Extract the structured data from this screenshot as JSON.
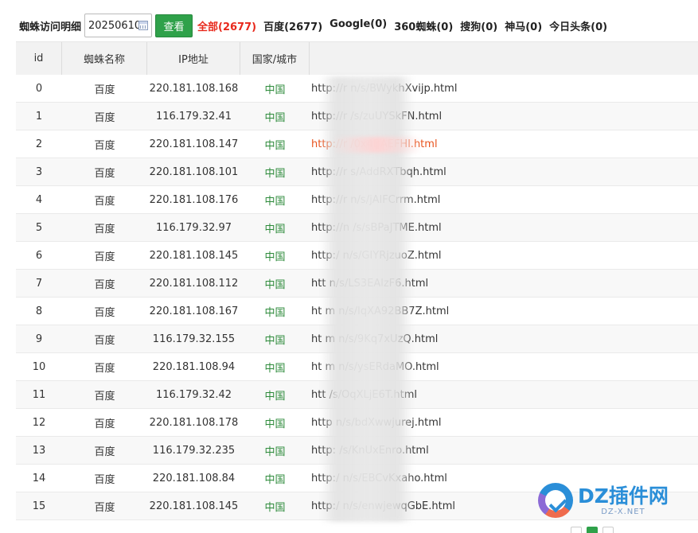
{
  "toolbar": {
    "title": "蜘蛛访问明细",
    "date_value": "20250610",
    "view_label": "查看",
    "filters": [
      {
        "label": "全部(2677)",
        "active": true
      },
      {
        "label": "百度(2677)",
        "active": false
      },
      {
        "label": "Google(0)",
        "active": false
      },
      {
        "label": "360蜘蛛(0)",
        "active": false
      },
      {
        "label": "搜狗(0)",
        "active": false
      },
      {
        "label": "神马(0)",
        "active": false
      },
      {
        "label": "今日头条(0)",
        "active": false
      }
    ]
  },
  "table": {
    "headers": [
      "id",
      "蜘蛛名称",
      "IP地址",
      "国家/城市"
    ],
    "rows": [
      {
        "id": "0",
        "name": "百度",
        "ip": "220.181.108.168",
        "geo": "中国",
        "url": "http://r           n/s/BWykhXvijp.html"
      },
      {
        "id": "1",
        "name": "百度",
        "ip": "116.179.32.41",
        "geo": "中国",
        "url": "http://r           /s/zuUYSkFN.html"
      },
      {
        "id": "2",
        "name": "百度",
        "ip": "220.181.108.147",
        "geo": "中国",
        "url": "http://r            /0x4BAEFHl.html"
      },
      {
        "id": "3",
        "name": "百度",
        "ip": "220.181.108.101",
        "geo": "中国",
        "url": "http://r           s/AddRXTbqh.html"
      },
      {
        "id": "4",
        "name": "百度",
        "ip": "220.181.108.176",
        "geo": "中国",
        "url": "http://r          n/s/jAlFCrrm.html"
      },
      {
        "id": "5",
        "name": "百度",
        "ip": "116.179.32.97",
        "geo": "中国",
        "url": "http://n          /s/sBPaJTME.html"
      },
      {
        "id": "6",
        "name": "百度",
        "ip": "220.181.108.145",
        "geo": "中国",
        "url": "http:/            n/s/GIYRjzuoZ.html"
      },
      {
        "id": "7",
        "name": "百度",
        "ip": "220.181.108.112",
        "geo": "中国",
        "url": "htt            n/s/LS3EAlzF6.html"
      },
      {
        "id": "8",
        "name": "百度",
        "ip": "220.181.108.167",
        "geo": "中国",
        "url": "ht      m      n/s/IqXA92BB7Z.html"
      },
      {
        "id": "9",
        "name": "百度",
        "ip": "116.179.32.155",
        "geo": "中国",
        "url": "ht      m      n/s/9Kq7xUzQ.html"
      },
      {
        "id": "10",
        "name": "百度",
        "ip": "220.181.108.94",
        "geo": "中国",
        "url": "ht      m      n/s/ysERdaMO.html"
      },
      {
        "id": "11",
        "name": "百度",
        "ip": "116.179.32.42",
        "geo": "中国",
        "url": "htt            /s/OqXLjE6T.html"
      },
      {
        "id": "12",
        "name": "百度",
        "ip": "220.181.108.178",
        "geo": "中国",
        "url": "http            n/s/bdXwwjurej.html"
      },
      {
        "id": "13",
        "name": "百度",
        "ip": "116.179.32.235",
        "geo": "中国",
        "url": "http:           /s/KnUxEnro.html"
      },
      {
        "id": "14",
        "name": "百度",
        "ip": "220.181.108.84",
        "geo": "中国",
        "url": "http:/           n/s/EBCvKxaho.html"
      },
      {
        "id": "15",
        "name": "百度",
        "ip": "220.181.108.145",
        "geo": "中国",
        "url": "http:/           n/s/enwjewqGbE.html"
      }
    ],
    "highlight_row_index": 2
  },
  "watermark": {
    "main": "DZ插件网",
    "sub": "DZ-X.NET"
  },
  "colors": {
    "active_filter": "#e8291c",
    "button_green": "#2fa14a",
    "geo_green": "#2e8b3b",
    "highlight_url": "#e8521c"
  }
}
